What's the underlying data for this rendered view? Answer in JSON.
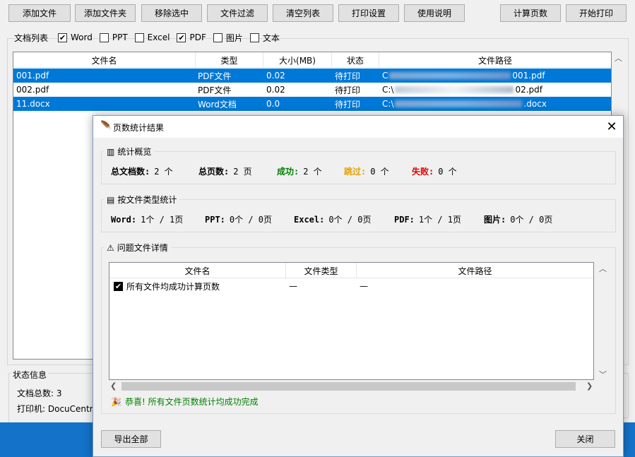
{
  "toolbar": {
    "add_file": "添加文件",
    "add_folder": "添加文件夹",
    "remove_selected": "移除选中",
    "file_filter": "文件过滤",
    "clear_list": "清空列表",
    "print_settings": "打印设置",
    "help": "使用说明",
    "count_pages": "计算页数",
    "start_print": "开始打印"
  },
  "filters": {
    "label": "文档列表",
    "items": [
      {
        "label": "Word",
        "checked": true
      },
      {
        "label": "PPT",
        "checked": false
      },
      {
        "label": "Excel",
        "checked": false
      },
      {
        "label": "PDF",
        "checked": true
      },
      {
        "label": "图片",
        "checked": false
      },
      {
        "label": "文本",
        "checked": false
      }
    ]
  },
  "file_table": {
    "columns": [
      "文件名",
      "类型",
      "大小(MB)",
      "状态",
      "文件路径"
    ],
    "rows": [
      {
        "name": "001.pdf",
        "type": "PDF文件",
        "size": "0.02",
        "status": "待打印",
        "path_start": "C",
        "path_end": "001.pdf",
        "selected": true
      },
      {
        "name": "002.pdf",
        "type": "PDF文件",
        "size": "0.02",
        "status": "待打印",
        "path_start": "C:\\",
        "path_end": "02.pdf",
        "selected": false
      },
      {
        "name": "11.docx",
        "type": "Word文档",
        "size": "0.0",
        "status": "待打印",
        "path_start": "C:\\",
        "path_end": ".docx",
        "selected": true
      }
    ]
  },
  "status_panel": {
    "title": "状态信息",
    "doc_count": "文档总数: 3",
    "printer": "打印机: DocuCentre"
  },
  "dialog": {
    "title": "页数统计结果",
    "close_glyph": "✕",
    "overview": {
      "title": "统计概览",
      "items": [
        {
          "label": "总文档数:",
          "value": "2 个",
          "color": "#000000"
        },
        {
          "label": "总页数:",
          "value": "2 页",
          "color": "#000000"
        },
        {
          "label": "成功:",
          "value": "2 个",
          "color": "#008000"
        },
        {
          "label": "跳过:",
          "value": "0 个",
          "color": "#e6a100"
        },
        {
          "label": "失败:",
          "value": "0 个",
          "color": "#e00000"
        }
      ]
    },
    "by_type": {
      "title": "按文件类型统计",
      "items": [
        {
          "label": "Word:",
          "value": "1个 / 1页"
        },
        {
          "label": "PPT:",
          "value": "0个 / 0页"
        },
        {
          "label": "Excel:",
          "value": "0个 / 0页"
        },
        {
          "label": "PDF:",
          "value": "1个 / 1页"
        },
        {
          "label": "图片:",
          "value": "0个 / 0页"
        }
      ]
    },
    "problems": {
      "title": "问题文件详情",
      "columns": [
        "文件名",
        "文件类型",
        "文件路径"
      ],
      "rows": [
        {
          "name": "所有文件均成功计算页数",
          "type": "—",
          "path": "—"
        }
      ]
    },
    "success_msg": "恭喜! 所有文件页数统计均成功完成",
    "export_all": "导出全部",
    "close": "关闭"
  },
  "colors": {
    "selection": "#0078d7",
    "success": "#008000",
    "taskbar": "#1472c9"
  }
}
